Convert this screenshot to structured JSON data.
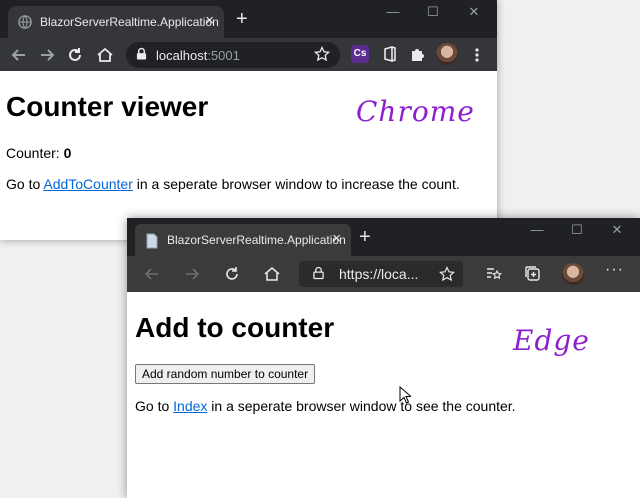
{
  "chrome": {
    "tab_title": "BlazorServerRealtime.Application",
    "close_glyph": "×",
    "new_tab_glyph": "+",
    "url_host": "localhost",
    "url_port": ":5001",
    "ext_cs_label": "Cs",
    "page": {
      "heading": "Counter viewer",
      "counter_label": "Counter: ",
      "counter_value": "0",
      "go_to": "Go to ",
      "link_text": "AddToCounter",
      "tail_text": " in a seperate browser window to increase the count."
    },
    "annotation": "Chrome",
    "window_controls": {
      "minimize": "—",
      "maximize": "☐",
      "close": "✕"
    }
  },
  "edge": {
    "tab_title": "BlazorServerRealtime.Application",
    "close_glyph": "×",
    "new_tab_glyph": "+",
    "url_text": "https://loca...",
    "more_glyph": "···",
    "page": {
      "heading": "Add to counter",
      "button_label": "Add random number to counter",
      "go_to": "Go to ",
      "link_text": "Index",
      "tail_text": " in a seperate browser window to see the counter."
    },
    "annotation": "Edge",
    "window_controls": {
      "minimize": "—",
      "maximize": "☐",
      "close": "✕"
    }
  },
  "colors": {
    "annotation": "#8d1fcf",
    "link": "#0366d6",
    "chrome_tabstrip": "#202124",
    "chrome_toolbar": "#35363a"
  }
}
